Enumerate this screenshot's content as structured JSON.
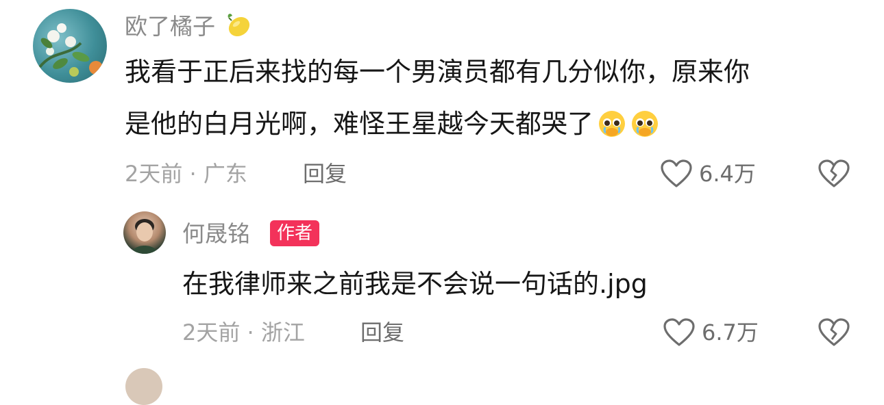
{
  "comments": [
    {
      "username": "欧了橘子",
      "username_emoji": "lemon-icon",
      "text_line1": "我看于正后来找的每一个男演员都有几分似你，原来你",
      "text_line2": "是他的白月光啊，难怪王星越今天都哭了",
      "text_emojis": [
        "pleading-face-icon",
        "pleading-face-icon"
      ],
      "time_location": "2天前 · 广东",
      "reply_label": "回复",
      "likes": "6.4万"
    }
  ],
  "replies": [
    {
      "username": "何晟铭",
      "badge": "作者",
      "text": "在我律师来之前我是不会说一句话的.jpg",
      "time_location": "2天前 · 浙江",
      "reply_label": "回复",
      "likes": "6.7万"
    }
  ],
  "colors": {
    "badge": "#f3325a",
    "username": "#8a8a8a",
    "meta": "#a3a3a3",
    "body": "#161616"
  }
}
